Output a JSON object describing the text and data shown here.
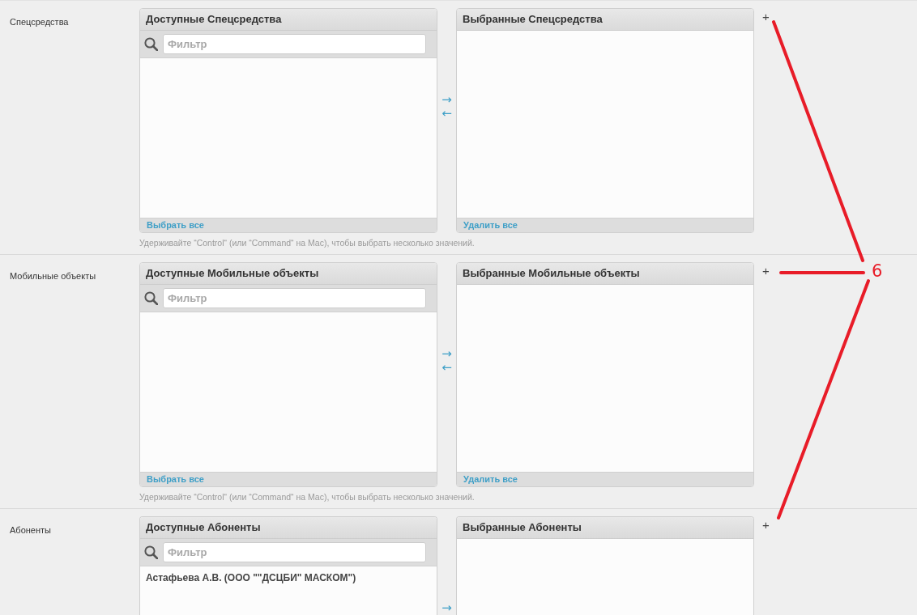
{
  "sections": [
    {
      "label": "Спецсредства",
      "available": {
        "title": "Доступные Спецсредства",
        "filter": {
          "placeholder": "Фильтр"
        },
        "action": "Выбрать все"
      },
      "arrows": [
        "→",
        "←"
      ],
      "chosen": {
        "title": "Выбранные Спецсредства",
        "action": "Удалить все"
      },
      "add": "+",
      "help": "Удерживайте “Control“ (или “Command“ на Mac), чтобы выбрать несколько значений."
    },
    {
      "label": "Мобильные объекты",
      "available": {
        "title": "Доступные Мобильные объекты",
        "filter": {
          "placeholder": "Фильтр"
        },
        "action": "Выбрать все"
      },
      "arrows": [
        "→",
        "←"
      ],
      "chosen": {
        "title": "Выбранные Мобильные объекты",
        "action": "Удалить все"
      },
      "add": "+",
      "help": "Удерживайте “Control“ (или “Command“ на Mac), чтобы выбрать несколько значений."
    },
    {
      "label": "Абоненты",
      "available": {
        "title": "Доступные Абоненты",
        "filter": {
          "placeholder": "Фильтр"
        },
        "items": [
          "Астафьева А.В. (ООО \"\"ДСЦБИ\" МАСКОМ\")"
        ]
      },
      "arrows": [
        "→"
      ],
      "chosen": {
        "title": "Выбранные Абоненты"
      },
      "add": "+"
    }
  ],
  "annotation": {
    "label": "6"
  }
}
